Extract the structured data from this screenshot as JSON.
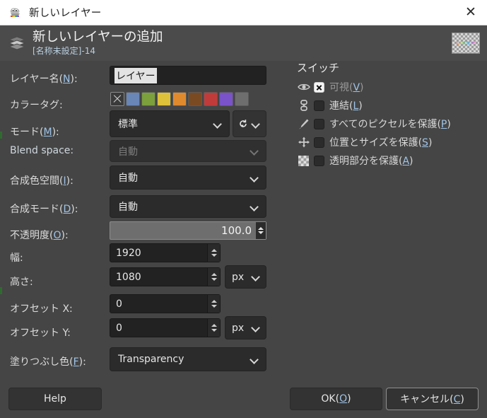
{
  "window": {
    "title": "新しいレイヤー",
    "icon": "gimp-wilber-icon",
    "close_label": "✕"
  },
  "header": {
    "title": "新しいレイヤーの追加",
    "subtitle": "[名称未設定]-14",
    "icon": "layers-icon",
    "thumbnail_text": "レイヤー"
  },
  "form": {
    "layer_name": {
      "label": "レイヤー名(N):",
      "value": "レイヤー",
      "selected": true
    },
    "color_tag": {
      "label": "カラータグ:",
      "swatches": [
        "none",
        "#6986b7",
        "#7ba03c",
        "#ddc13a",
        "#e08a2e",
        "#7a4a23",
        "#c23b3b",
        "#7a52c9",
        "#6e6e6e"
      ]
    },
    "mode": {
      "label": "モード(M):",
      "value": "標準",
      "reset_icon": "reset-arrow-icon"
    },
    "blend_space": {
      "label": "Blend space:",
      "value": "自動",
      "disabled": true
    },
    "composite_space": {
      "label": "合成色空間(I):",
      "value": "自動"
    },
    "composite_mode": {
      "label": "合成モード(D):",
      "value": "自動"
    },
    "opacity": {
      "label": "不透明度(O):",
      "value": "100.0",
      "percent": 100
    },
    "width": {
      "label": "幅:",
      "value": "1920"
    },
    "height": {
      "label": "高さ:",
      "value": "1080",
      "unit": "px"
    },
    "offset_x": {
      "label": "オフセット X:",
      "value": "0"
    },
    "offset_y": {
      "label": "オフセット Y:",
      "value": "0",
      "unit": "px"
    },
    "fill_color": {
      "label": "塗りつぶし色(F):",
      "value": "Transparency"
    }
  },
  "switches": {
    "title": "スイッチ",
    "items": [
      {
        "icon": "eye-icon",
        "label": "可視(V)",
        "checked": true,
        "dim": true
      },
      {
        "icon": "chain-link-icon",
        "label": "連結(L)",
        "checked": false,
        "dim": false
      },
      {
        "icon": "paintbrush-icon",
        "label": "すべてのピクセルを保護(P)",
        "checked": false,
        "dim": false
      },
      {
        "icon": "move-arrows-icon",
        "label": "位置とサイズを保護(S)",
        "checked": false,
        "dim": false
      },
      {
        "icon": "checkerboard-icon",
        "label": "透明部分を保護(A)",
        "checked": false,
        "dim": false
      }
    ]
  },
  "footer": {
    "help": "Help",
    "ok": "OK(O)",
    "cancel": "キャンセル(C)"
  },
  "colors": {
    "dialog_bg": "#454545",
    "header_bg": "#4b4b4b",
    "entry_bg": "#222222",
    "accent_link": "#9fc4e8",
    "titlebar_bg": "#ffffff"
  }
}
